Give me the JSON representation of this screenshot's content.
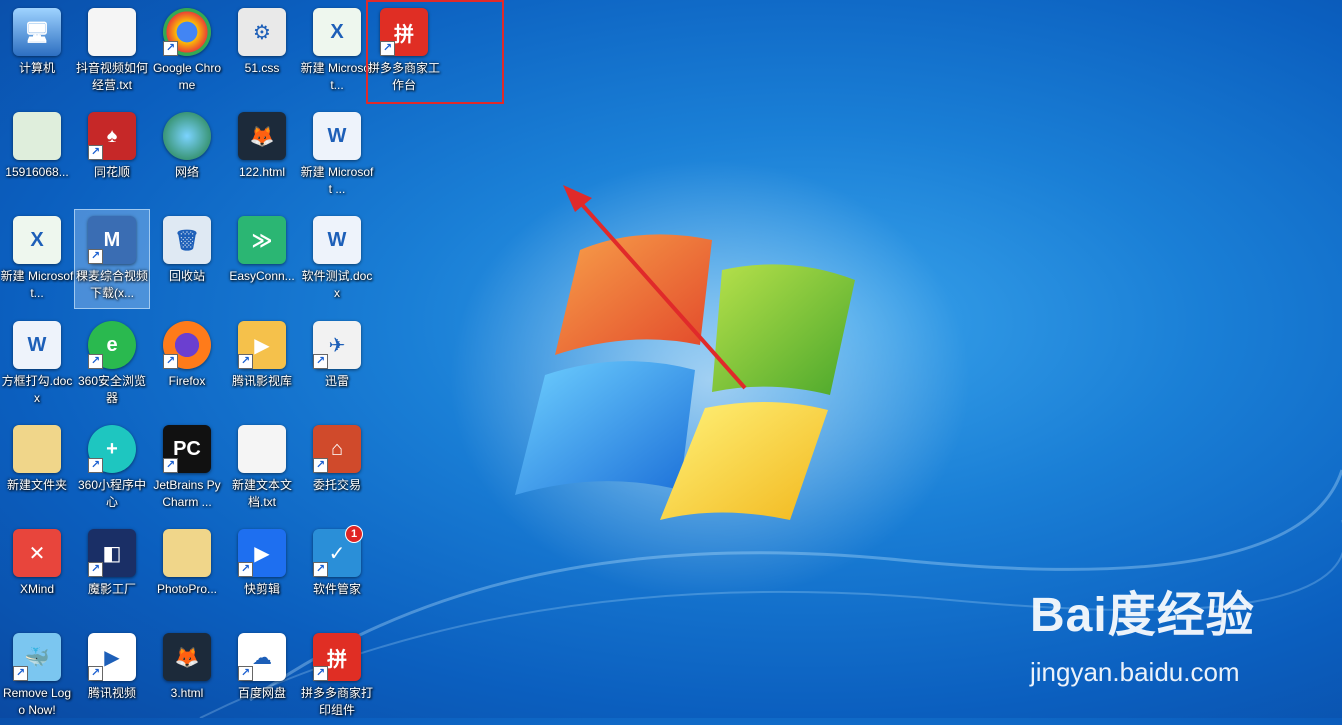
{
  "desktop": {
    "icons": [
      {
        "label": "计算机"
      },
      {
        "label": "抖音视频如何经营.txt"
      },
      {
        "label": "Google Chrome"
      },
      {
        "label": "51.css"
      },
      {
        "label": "新建 Microsoft..."
      },
      {
        "label": "拼多多商家工作台"
      },
      {
        "label": "15916068..."
      },
      {
        "label": "同花顺"
      },
      {
        "label": "网络"
      },
      {
        "label": "122.html"
      },
      {
        "label": "新建 Microsoft ..."
      },
      {
        "label": "新建 Microsoft..."
      },
      {
        "label": "稞麦综合视频下载(x..."
      },
      {
        "label": "回收站"
      },
      {
        "label": "EasyConn..."
      },
      {
        "label": "软件测试.docx"
      },
      {
        "label": "方框打勾.docx"
      },
      {
        "label": "360安全浏览器"
      },
      {
        "label": "Firefox"
      },
      {
        "label": "腾讯影视库"
      },
      {
        "label": "迅雷"
      },
      {
        "label": "新建文件夹"
      },
      {
        "label": "360小程序中心"
      },
      {
        "label": "JetBrains PyCharm ..."
      },
      {
        "label": "新建文本文档.txt"
      },
      {
        "label": "委托交易"
      },
      {
        "label": "XMind"
      },
      {
        "label": "魔影工厂"
      },
      {
        "label": "PhotoPro..."
      },
      {
        "label": "快剪辑"
      },
      {
        "label": "软件管家"
      },
      {
        "label": "Remove Logo Now!"
      },
      {
        "label": "腾讯视频"
      },
      {
        "label": "3.html"
      },
      {
        "label": "百度网盘"
      },
      {
        "label": "拼多多商家打印组件"
      }
    ],
    "badge_count": "1"
  },
  "watermark": {
    "brand": "Bai度经验",
    "site": "jingyan.baidu.com"
  },
  "colors": {
    "annotation": "#e02a2a",
    "desktop": "#1a7fd6"
  }
}
